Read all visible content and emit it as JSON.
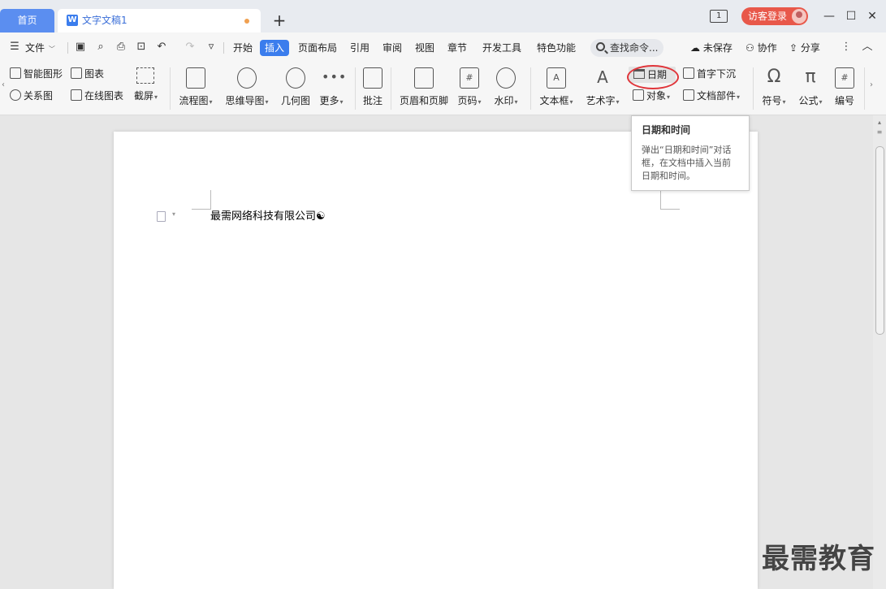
{
  "titlebar": {
    "home_tab": "首页",
    "doc_tab": "文字文稿1",
    "window_count": "1",
    "login": "访客登录"
  },
  "menubar": {
    "file": "文件",
    "items": [
      "开始",
      "插入",
      "页面布局",
      "引用",
      "审阅",
      "视图",
      "章节",
      "开发工具",
      "特色功能"
    ],
    "active": "插入",
    "search_placeholder": "查找命令...",
    "unsaved": "未保存",
    "collab": "协作",
    "share": "分享"
  },
  "ribbon": {
    "smart_shape": "智能图形",
    "chart": "图表",
    "relation": "关系图",
    "online_chart": "在线图表",
    "screenshot": "截屏",
    "flowchart": "流程图",
    "mindmap": "思维导图",
    "geometry": "几何图",
    "more": "更多",
    "comment": "批注",
    "header_footer": "页眉和页脚",
    "page_number": "页码",
    "watermark": "水印",
    "textbox": "文本框",
    "wordart": "艺术字",
    "date": "日期",
    "object": "对象",
    "dropcap": "首字下沉",
    "doc_parts": "文档部件",
    "symbol": "符号",
    "formula": "公式",
    "numbering": "编号"
  },
  "tooltip": {
    "title": "日期和时间",
    "body": "弹出“日期和时间”对话框，在文档中插入当前日期和时间。"
  },
  "document": {
    "text": "最需网络科技有限公司☯"
  },
  "watermark_text": "最需教育",
  "colors": {
    "accent": "#3b7ded",
    "login": "#e8584a",
    "highlight_ring": "#e0353a"
  }
}
